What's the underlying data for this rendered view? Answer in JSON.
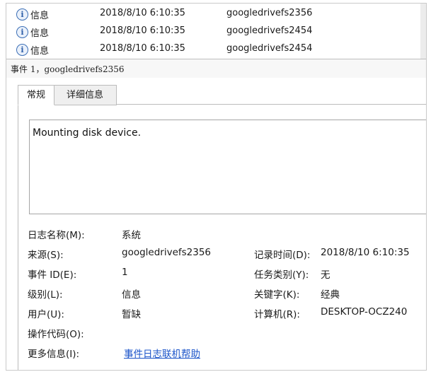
{
  "events": [
    {
      "level": "信息",
      "date": "2018/8/10 6:10:35",
      "source": "googledrivefs2356",
      "icon": "info-icon"
    },
    {
      "level": "信息",
      "date": "2018/8/10 6:10:35",
      "source": "googledrivefs2454",
      "icon": "info-icon"
    },
    {
      "level": "信息",
      "date": "2018/8/10 6:10:35",
      "source": "googledrivefs2454",
      "icon": "info-icon"
    }
  ],
  "info_glyph": "i",
  "event_title": "事件 1，googledrivefs2356",
  "tabs": {
    "general": "常规",
    "details": "详细信息"
  },
  "description": "Mounting disk device.",
  "fields": {
    "log_name": {
      "label": "日志名称(M):",
      "value": "系统"
    },
    "source": {
      "label": "来源(S):",
      "value": "googledrivefs2356"
    },
    "logged": {
      "label": "记录时间(D):",
      "value": "2018/8/10 6:10:35"
    },
    "event_id": {
      "label": "事件 ID(E):",
      "value": "1"
    },
    "task_cat": {
      "label": "任务类别(Y):",
      "value": "无"
    },
    "level": {
      "label": "级别(L):",
      "value": "信息"
    },
    "keywords": {
      "label": "关键字(K):",
      "value": "经典"
    },
    "user": {
      "label": "用户(U):",
      "value": "暂缺"
    },
    "computer": {
      "label": "计算机(R):",
      "value": "DESKTOP-OCZ240"
    },
    "opcode": {
      "label": "操作代码(O):",
      "value": ""
    },
    "more_info": {
      "label": "更多信息(I):",
      "value": "事件日志联机帮助"
    }
  },
  "colors": {
    "link": "#1a53c9",
    "info_icon": "#2d5ea8"
  }
}
